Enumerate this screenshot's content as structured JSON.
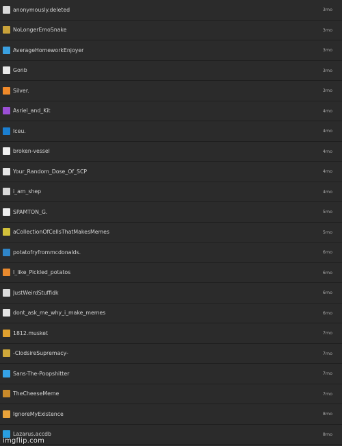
{
  "rows": [
    {
      "username": "anonymously.deleted",
      "time": "3mo",
      "avatar": "#d9d9d9"
    },
    {
      "username": "NoLongerEmoSnake",
      "time": "3mo",
      "avatar": "#c9a23a"
    },
    {
      "username": "AverageHomeworkEnjoyer",
      "time": "3mo",
      "avatar": "#3aa0e0"
    },
    {
      "username": "Gonb",
      "time": "3mo",
      "avatar": "#e8e8e8"
    },
    {
      "username": "Silver.",
      "time": "3mo",
      "avatar": "#f08a2a"
    },
    {
      "username": "Asriel_and_Kit",
      "time": "4mo",
      "avatar": "#9b4fd6"
    },
    {
      "username": "Iceu.",
      "time": "4mo",
      "avatar": "#1b7fd1"
    },
    {
      "username": "broken-vessel",
      "time": "4mo",
      "avatar": "#f0f0f0"
    },
    {
      "username": "Your_Random_Dose_Of_SCP",
      "time": "4mo",
      "avatar": "#e6e6e6"
    },
    {
      "username": "i_am_shep",
      "time": "4mo",
      "avatar": "#d8d8d8"
    },
    {
      "username": "SPAMTON_G.",
      "time": "5mo",
      "avatar": "#eeeeee"
    },
    {
      "username": "aCollectionOfCellsThatMakesMemes",
      "time": "5mo",
      "avatar": "#d2c13b"
    },
    {
      "username": "potatofryfrommcdonalds.",
      "time": "6mo",
      "avatar": "#2f85c8"
    },
    {
      "username": "I_like_Pickled_potatos",
      "time": "6mo",
      "avatar": "#e98a2e"
    },
    {
      "username": "JustWeirdStuffidk",
      "time": "6mo",
      "avatar": "#dcdcdc"
    },
    {
      "username": "dont_ask_me_why_i_make_memes",
      "time": "6mo",
      "avatar": "#e3e3e3"
    },
    {
      "username": "1812.musket",
      "time": "7mo",
      "avatar": "#e0a12f"
    },
    {
      "username": "-ClodsireSupremacy-",
      "time": "7mo",
      "avatar": "#cfa83a"
    },
    {
      "username": "Sans-The-Poopshitter",
      "time": "7mo",
      "avatar": "#35a2e6"
    },
    {
      "username": "TheCheeseMeme",
      "time": "7mo",
      "avatar": "#c98a2a"
    },
    {
      "username": "IgnoreMyExistence",
      "time": "8mo",
      "avatar": "#e9a33a"
    },
    {
      "username": "Lazarus.accdb",
      "time": "8mo",
      "avatar": "#2a9fe0"
    }
  ],
  "watermark": "imgflip.com"
}
